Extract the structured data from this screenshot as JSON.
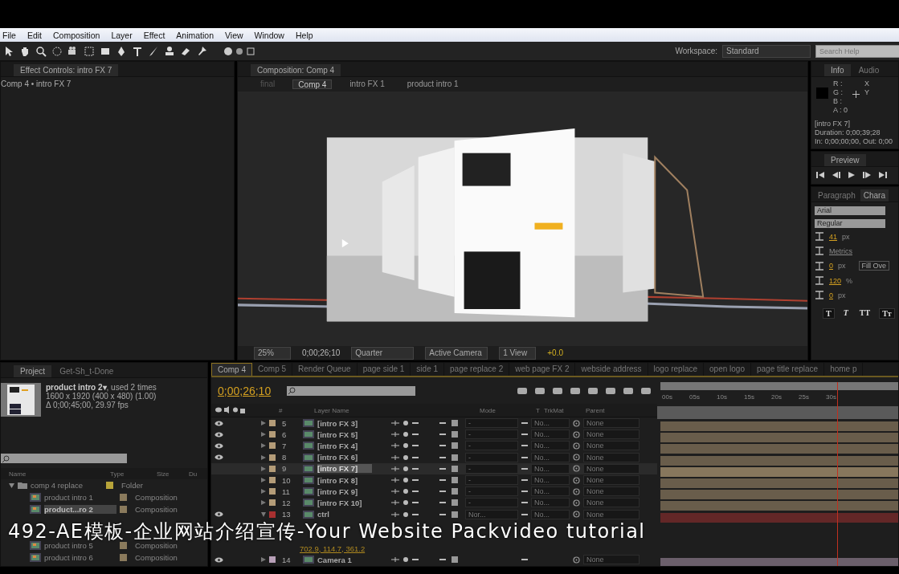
{
  "menu": [
    "File",
    "Edit",
    "Composition",
    "Layer",
    "Effect",
    "Animation",
    "View",
    "Window",
    "Help"
  ],
  "toolbar": {
    "workspace_label": "Workspace:",
    "workspace": "Standard",
    "search_placeholder": "Search Help"
  },
  "effect_controls": {
    "tab": "Effect Controls: intro FX 7",
    "path": "Comp 4 • intro FX 7"
  },
  "composition": {
    "tab": "Composition: Comp 4",
    "breadcrumbs": [
      {
        "label": "final",
        "selected": false
      },
      {
        "label": "Comp 4",
        "selected": true
      },
      {
        "label": "intro FX 1",
        "selected": false
      },
      {
        "label": "product intro 1",
        "selected": false
      }
    ],
    "footer": {
      "zoom": "25%",
      "time": "0;00;26;10",
      "resolution": "Quarter",
      "view": "Active Camera",
      "layout": "1 View",
      "exposure": "+0.0"
    }
  },
  "info": {
    "tabs": [
      {
        "label": "Info",
        "selected": true
      },
      {
        "label": "Audio",
        "selected": false
      }
    ],
    "channels": [
      "R :",
      "G :",
      "B :",
      "A : 0"
    ],
    "axes": [
      "X",
      "Y"
    ],
    "lines": [
      "[intro FX 7]",
      "Duration: 0;00;39;28",
      "In: 0;00;00;00, Out: 0;00"
    ]
  },
  "preview": {
    "tab": "Preview"
  },
  "character": {
    "tabs": [
      {
        "label": "Paragraph",
        "selected": false
      },
      {
        "label": "Chara",
        "selected": true
      }
    ],
    "font": "Arial",
    "style": "Regular",
    "fields": [
      {
        "value": "41",
        "unit": "px"
      },
      {
        "value": "Metrics"
      },
      {
        "value": "0",
        "unit": "px"
      },
      {
        "value": "120",
        "unit": "%"
      },
      {
        "value": "0",
        "unit": "px"
      }
    ],
    "fill_mode": "Fill Ove",
    "style_buttons": [
      {
        "label": "T",
        "selected": true
      },
      {
        "label": "T",
        "selected": false
      },
      {
        "label": "TT",
        "selected": false
      },
      {
        "label": "Tт",
        "selected": true
      }
    ]
  },
  "project": {
    "tabs": [
      {
        "label": "Project",
        "selected": true
      },
      {
        "label": "Get-Sh_t-Done",
        "selected": false
      }
    ],
    "item_name": "product intro 2▾",
    "item_usage": ", used 2 times",
    "item_size": "1600 x 1920  (400 x 480) (1.00)",
    "item_duration": "Δ 0;00;45;00, 29.97 fps",
    "columns": [
      "Name",
      "Type",
      "Size",
      "Du"
    ],
    "rows": [
      {
        "name": "comp 4 replace",
        "type": "Folder",
        "kind": "folder",
        "color": "#b8a43a",
        "selected": false,
        "expanded": true
      },
      {
        "name": "product intro 1",
        "type": "Composition",
        "kind": "comp",
        "color": "#8a7a5c",
        "selected": false
      },
      {
        "name": "product...ro 2",
        "type": "Composition",
        "kind": "comp",
        "color": "#8a7a5c",
        "selected": true
      },
      {
        "name": "product intro 5",
        "type": "Composition",
        "kind": "comp",
        "color": "#8a7a5c",
        "selected": false
      },
      {
        "name": "product intro 6",
        "type": "Composition",
        "kind": "comp",
        "color": "#8a7a5c",
        "selected": false
      }
    ]
  },
  "timeline": {
    "tabs": [
      {
        "label": "Comp 4",
        "selected": true
      },
      {
        "label": "Comp 5",
        "selected": false
      },
      {
        "label": "Render Queue",
        "selected": false
      },
      {
        "label": "page side 1",
        "selected": false
      },
      {
        "label": "side 1",
        "selected": false
      },
      {
        "label": "page replace 2",
        "selected": false
      },
      {
        "label": "web page FX 2",
        "selected": false
      },
      {
        "label": "webside address",
        "selected": false
      },
      {
        "label": "logo replace",
        "selected": false
      },
      {
        "label": "open logo",
        "selected": false
      },
      {
        "label": "page title replace",
        "selected": false
      },
      {
        "label": "home p",
        "selected": false
      }
    ],
    "time": "0;00;26;10",
    "columns": [
      "#",
      "Layer Name",
      "Mode",
      "T",
      "TrkMat",
      "Parent"
    ],
    "ruler": [
      "00s",
      "05s",
      "10s",
      "15s",
      "20s",
      "25s",
      "30s"
    ],
    "playhead": {
      "level": 0.745
    },
    "layers": [
      {
        "num": "5",
        "name": "[intro FX 3]",
        "color": "#b49c78",
        "visible": true,
        "selected": false,
        "expanded": false,
        "mode": "-",
        "trkmat": "No...",
        "parent": "None"
      },
      {
        "num": "6",
        "name": "[intro FX 5]",
        "color": "#b49c78",
        "visible": true,
        "selected": false,
        "expanded": false,
        "mode": "-",
        "trkmat": "No...",
        "parent": "None"
      },
      {
        "num": "7",
        "name": "[intro FX 4]",
        "color": "#b49c78",
        "visible": true,
        "selected": false,
        "expanded": false,
        "mode": "-",
        "trkmat": "No...",
        "parent": "None"
      },
      {
        "num": "8",
        "name": "[intro FX 6]",
        "color": "#b49c78",
        "visible": true,
        "selected": false,
        "expanded": false,
        "mode": "-",
        "trkmat": "No...",
        "parent": "None"
      },
      {
        "num": "9",
        "name": "[intro FX 7]",
        "color": "#b49c78",
        "visible": false,
        "selected": true,
        "expanded": false,
        "mode": "-",
        "trkmat": "No...",
        "parent": "None"
      },
      {
        "num": "10",
        "name": "[intro FX 8]",
        "color": "#b49c78",
        "visible": false,
        "selected": false,
        "expanded": false,
        "mode": "-",
        "trkmat": "No...",
        "parent": "None"
      },
      {
        "num": "11",
        "name": "[intro FX 9]",
        "color": "#b49c78",
        "visible": false,
        "selected": false,
        "expanded": false,
        "mode": "-",
        "trkmat": "No...",
        "parent": "None"
      },
      {
        "num": "12",
        "name": "[intro FX 10]",
        "color": "#b49c78",
        "visible": false,
        "selected": false,
        "expanded": false,
        "mode": "-",
        "trkmat": "No...",
        "parent": "None"
      },
      {
        "num": "13",
        "name": "ctrl",
        "color": "#a83030",
        "visible": true,
        "selected": false,
        "expanded": true,
        "mode": "Nor...",
        "trkmat": "No...",
        "parent": "None",
        "property_value": "702.9, 114.7, 361.2"
      },
      {
        "num": "14",
        "name": "Camera 1",
        "color": "#b8a0b8",
        "visible": true,
        "selected": false,
        "expanded": false,
        "parent": "None"
      }
    ]
  },
  "caption": "492-AE模板-企业网站介绍宣传-Your Website Packvideo tutorial"
}
